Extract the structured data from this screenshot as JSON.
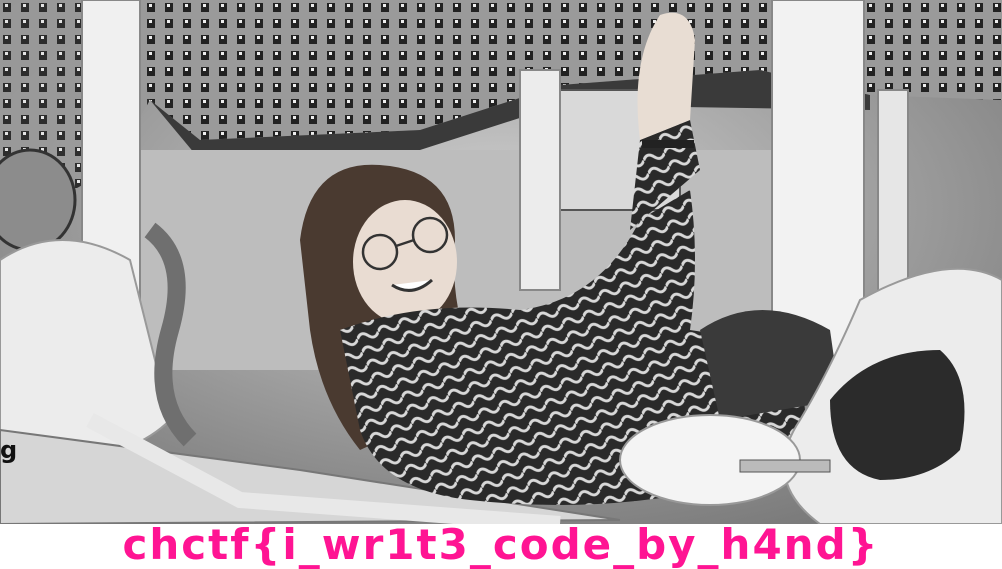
{
  "photo": {
    "description_icon": "photo-icon",
    "edge_letter": "g"
  },
  "caption": {
    "text": "chctf{i_wr1t3_code_by_h4nd}",
    "color": "#ff1493"
  },
  "colors": {
    "background": "#ffffff",
    "caption": "#ff1493"
  }
}
